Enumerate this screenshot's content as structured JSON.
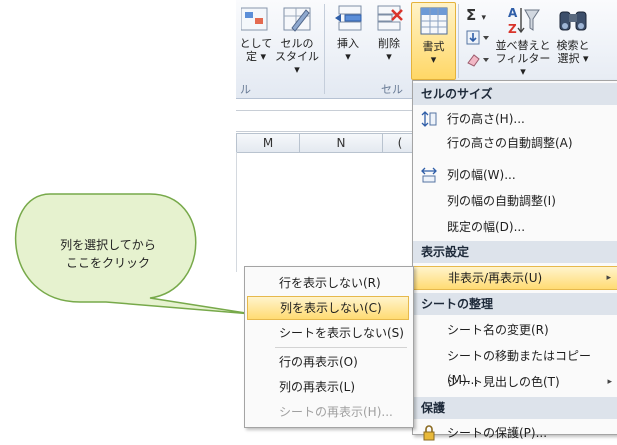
{
  "ribbon": {
    "styles_group": {
      "cond_format_label_line2": "定 ▾",
      "cond_format_label_line1": "として",
      "cell_style_label_line1": "セルの",
      "cell_style_label_line2": "スタイル ▾",
      "group_label_fragment": "ル"
    },
    "cells_group": {
      "insert_label": "挿入",
      "delete_label": "削除",
      "format_label": "書式",
      "group_label": "セル",
      "dropdown_arrow": "▾"
    },
    "editing_group": {
      "sum_symbol": "Σ",
      "sort_label_line1": "並べ替えと",
      "sort_label_line2": "フィルター ▾",
      "find_label_line1": "検索と",
      "find_label_line2": "選択 ▾"
    }
  },
  "sheet": {
    "columns": [
      "M",
      "N",
      "("
    ]
  },
  "format_menu": {
    "sections": [
      {
        "title": "セルのサイズ",
        "items": [
          {
            "label": "行の高さ(H)...",
            "icon": "row-height-icon"
          },
          {
            "label": "行の高さの自動調整(A)",
            "icon": ""
          },
          {
            "label": "列の幅(W)...",
            "icon": "column-width-icon"
          },
          {
            "label": "列の幅の自動調整(I)",
            "icon": ""
          },
          {
            "label": "既定の幅(D)...",
            "icon": ""
          }
        ]
      },
      {
        "title": "表示設定",
        "items": [
          {
            "label": "非表示/再表示(U)",
            "icon": "",
            "has_submenu": true,
            "highlighted": true
          }
        ]
      },
      {
        "title": "シートの整理",
        "items": [
          {
            "label": "シート名の変更(R)",
            "icon": ""
          },
          {
            "label": "シートの移動またはコピー(M)...",
            "icon": ""
          },
          {
            "label": "シート見出しの色(T)",
            "icon": "",
            "has_submenu": true
          }
        ]
      },
      {
        "title": "保護",
        "items": [
          {
            "label": "シートの保護(P)...",
            "icon": "lock-icon"
          }
        ]
      }
    ],
    "submenu_arrow": "▸"
  },
  "hide_submenu": {
    "items": [
      {
        "label": "行を表示しない(R)",
        "highlighted": false,
        "disabled": false
      },
      {
        "label": "列を表示しない(C)",
        "highlighted": true,
        "disabled": false
      },
      {
        "label": "シートを表示しない(S)",
        "highlighted": false,
        "disabled": false
      },
      {
        "label": "行の再表示(O)",
        "highlighted": false,
        "disabled": false
      },
      {
        "label": "列の再表示(L)",
        "highlighted": false,
        "disabled": false
      },
      {
        "label": "シートの再表示(H)...",
        "highlighted": false,
        "disabled": true
      }
    ]
  },
  "callout": {
    "line1": "列を選択してから",
    "line2": "ここをクリック",
    "fill_color": "#e6f2cf",
    "border_color": "#77a94a"
  },
  "colors": {
    "highlight": "#ffdb73",
    "section_bg": "#dde3eb",
    "ribbon_bg": "#e3e9f2"
  }
}
